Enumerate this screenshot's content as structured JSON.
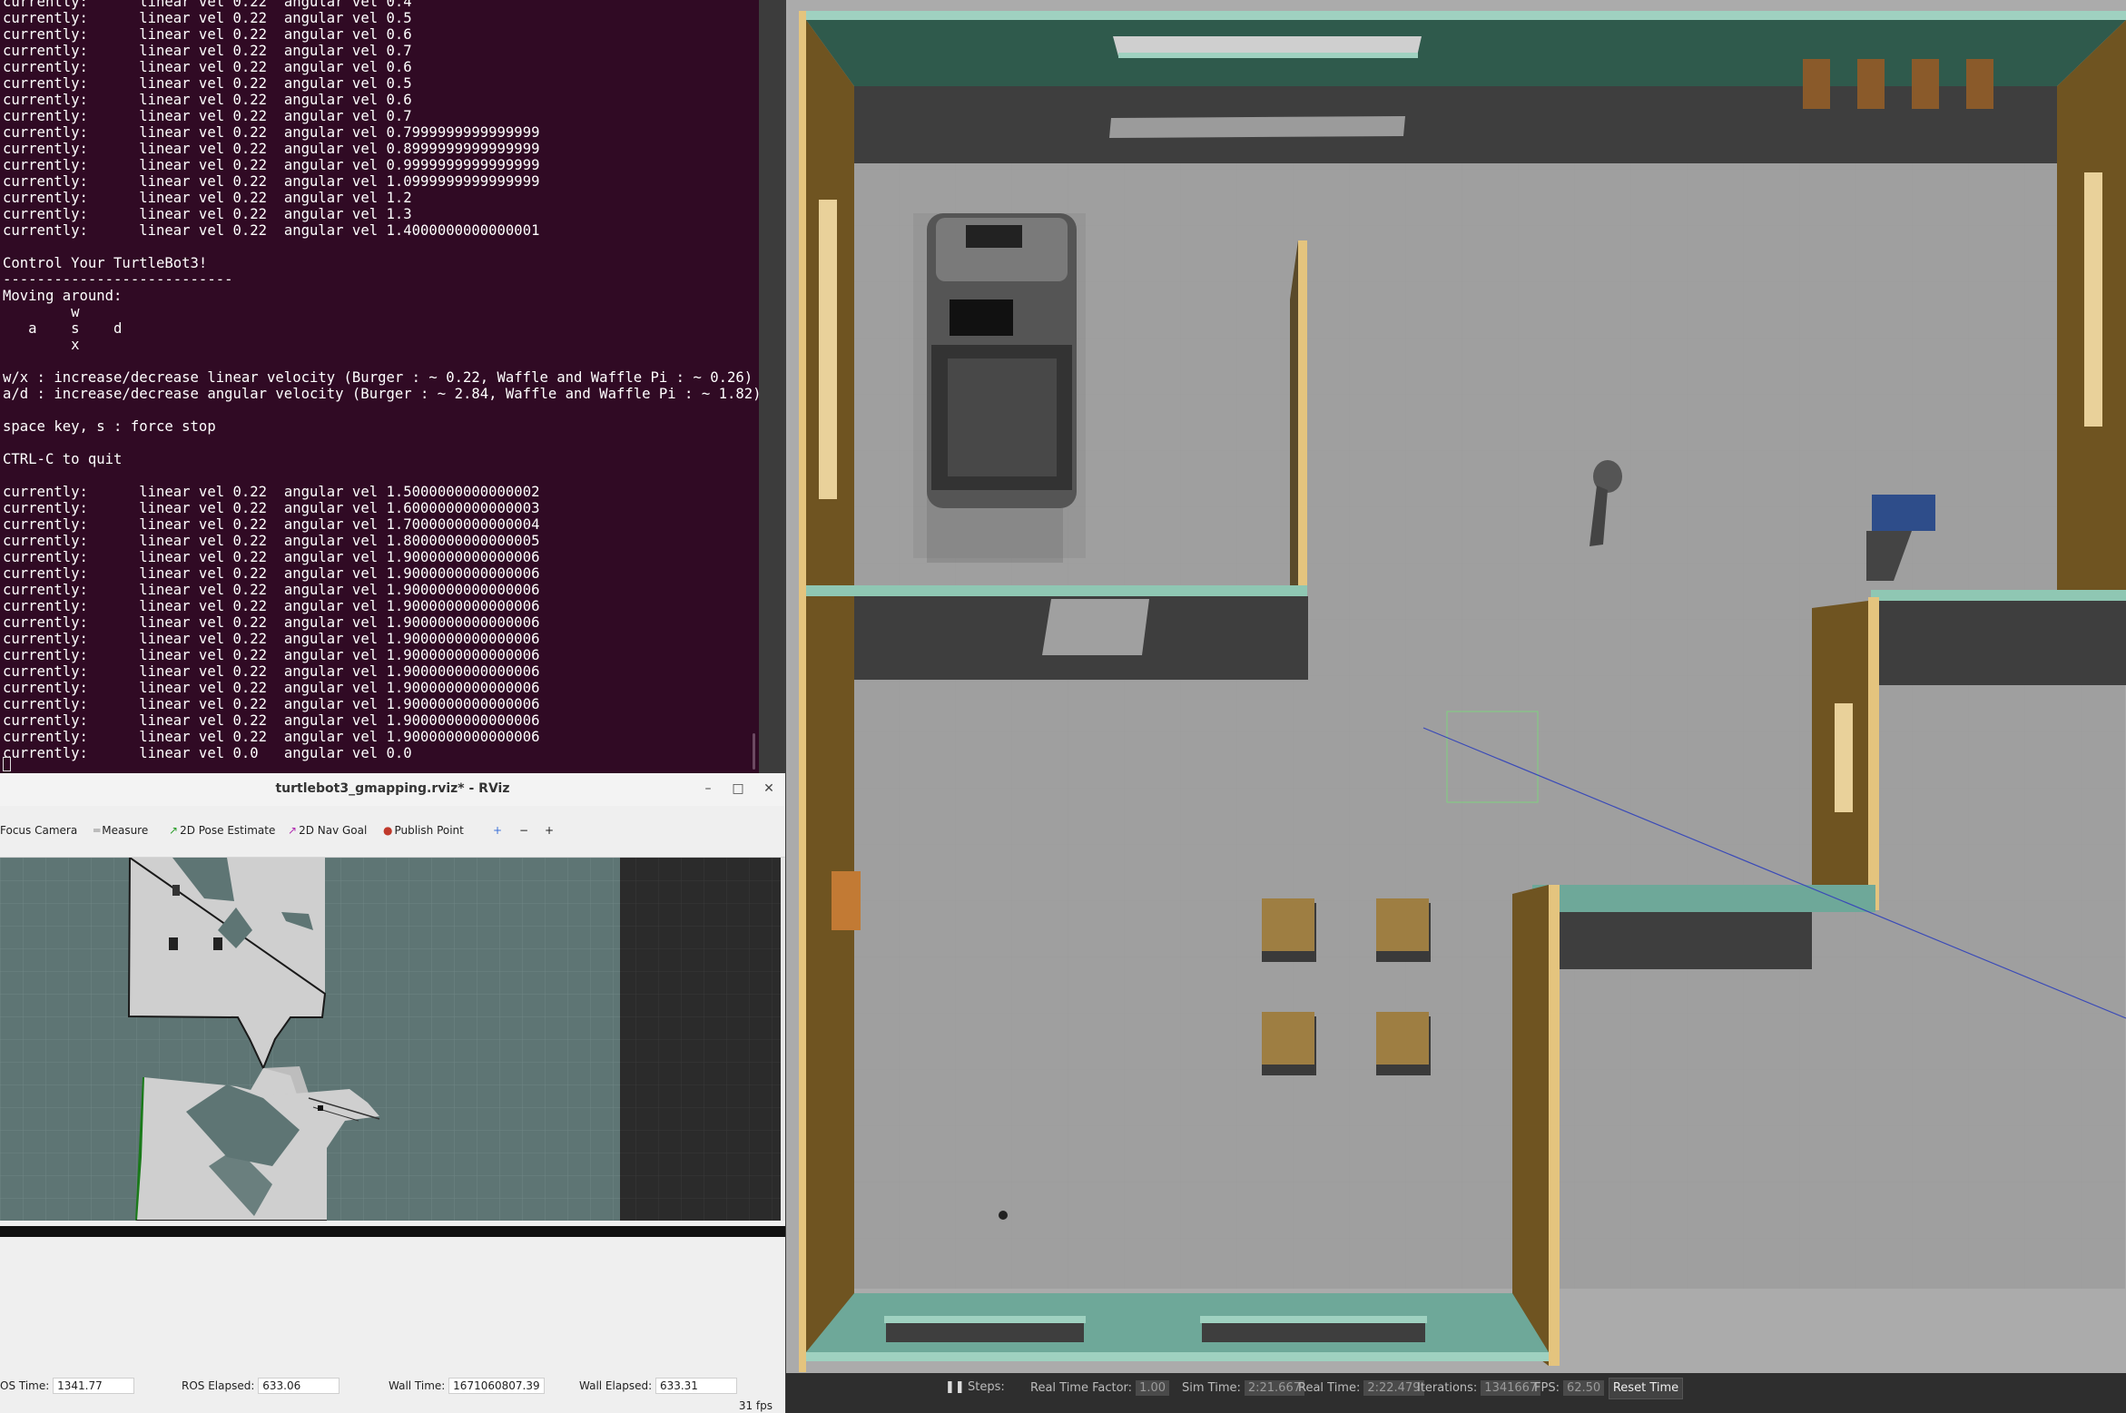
{
  "terminal": {
    "lines": [
      "currently:\tlinear vel 0.22\t angular vel 0.4",
      "currently:\tlinear vel 0.22\t angular vel 0.5",
      "currently:\tlinear vel 0.22\t angular vel 0.6",
      "currently:\tlinear vel 0.22\t angular vel 0.7",
      "currently:\tlinear vel 0.22\t angular vel 0.6",
      "currently:\tlinear vel 0.22\t angular vel 0.5",
      "currently:\tlinear vel 0.22\t angular vel 0.6",
      "currently:\tlinear vel 0.22\t angular vel 0.7",
      "currently:\tlinear vel 0.22\t angular vel 0.7999999999999999",
      "currently:\tlinear vel 0.22\t angular vel 0.8999999999999999",
      "currently:\tlinear vel 0.22\t angular vel 0.9999999999999999",
      "currently:\tlinear vel 0.22\t angular vel 1.0999999999999999",
      "currently:\tlinear vel 0.22\t angular vel 1.2",
      "currently:\tlinear vel 0.22\t angular vel 1.3",
      "currently:\tlinear vel 0.22\t angular vel 1.4000000000000001",
      "",
      "Control Your TurtleBot3!",
      "---------------------------",
      "Moving around:",
      "        w",
      "   a    s    d",
      "        x",
      "",
      "w/x : increase/decrease linear velocity (Burger : ~ 0.22, Waffle and Waffle Pi : ~ 0.26)",
      "a/d : increase/decrease angular velocity (Burger : ~ 2.84, Waffle and Waffle Pi : ~ 1.82)",
      "",
      "space key, s : force stop",
      "",
      "CTRL-C to quit",
      "",
      "currently:\tlinear vel 0.22\t angular vel 1.5000000000000002",
      "currently:\tlinear vel 0.22\t angular vel 1.6000000000000003",
      "currently:\tlinear vel 0.22\t angular vel 1.7000000000000004",
      "currently:\tlinear vel 0.22\t angular vel 1.8000000000000005",
      "currently:\tlinear vel 0.22\t angular vel 1.9000000000000006",
      "currently:\tlinear vel 0.22\t angular vel 1.9000000000000006",
      "currently:\tlinear vel 0.22\t angular vel 1.9000000000000006",
      "currently:\tlinear vel 0.22\t angular vel 1.9000000000000006",
      "currently:\tlinear vel 0.22\t angular vel 1.9000000000000006",
      "currently:\tlinear vel 0.22\t angular vel 1.9000000000000006",
      "currently:\tlinear vel 0.22\t angular vel 1.9000000000000006",
      "currently:\tlinear vel 0.22\t angular vel 1.9000000000000006",
      "currently:\tlinear vel 0.22\t angular vel 1.9000000000000006",
      "currently:\tlinear vel 0.22\t angular vel 1.9000000000000006",
      "currently:\tlinear vel 0.22\t angular vel 1.9000000000000006",
      "currently:\tlinear vel 0.22\t angular vel 1.9000000000000006",
      "currently:\tlinear vel 0.0\t angular vel 0.0"
    ]
  },
  "rviz": {
    "window_title": "turtlebot3_gmapping.rviz* - RViz",
    "buttons": {
      "minimize": "–",
      "maximize": "□",
      "close": "✕"
    },
    "toolbar": {
      "focus_camera": "Focus Camera",
      "measure": "Measure",
      "pose_estimate": "2D Pose Estimate",
      "nav_goal": "2D Nav Goal",
      "publish_point": "Publish Point",
      "add_tool": "+",
      "remove_tool": "−",
      "tool_options": "+"
    },
    "status": {
      "ros_time_label": "OS Time:",
      "ros_time": "1341.77",
      "ros_elapsed_label": "ROS Elapsed:",
      "ros_elapsed": "633.06",
      "wall_time_label": "Wall Time:",
      "wall_time": "1671060807.39",
      "wall_elapsed_label": "Wall Elapsed:",
      "wall_elapsed": "633.31",
      "fps": "31 fps"
    },
    "icons": {
      "measure": "ruler-icon",
      "pose": "green-arrow-icon",
      "goal": "magenta-arrow-icon",
      "point": "pin-icon",
      "add": "plus-icon"
    }
  },
  "gazebo": {
    "pause": "❚❚",
    "steps_label": "Steps:",
    "rtf_label": "Real Time Factor:",
    "rtf": "1.00",
    "sim_time_label": "Sim Time:",
    "sim_time": "2:21.667",
    "real_time_label": "Real Time:",
    "real_time": "2:22.479",
    "iterations_label": "Iterations:",
    "iterations": "1341667",
    "fps_label": "FPS:",
    "fps": "62.50",
    "reset_time": "Reset Time"
  },
  "colors": {
    "terminal_bg": "#300a24",
    "rviz_view_bg": "#5e7574",
    "gazebo_floor": "#a9a9a9",
    "wall_top": "#8fc7b3",
    "wall_brown": "#6e5320"
  }
}
